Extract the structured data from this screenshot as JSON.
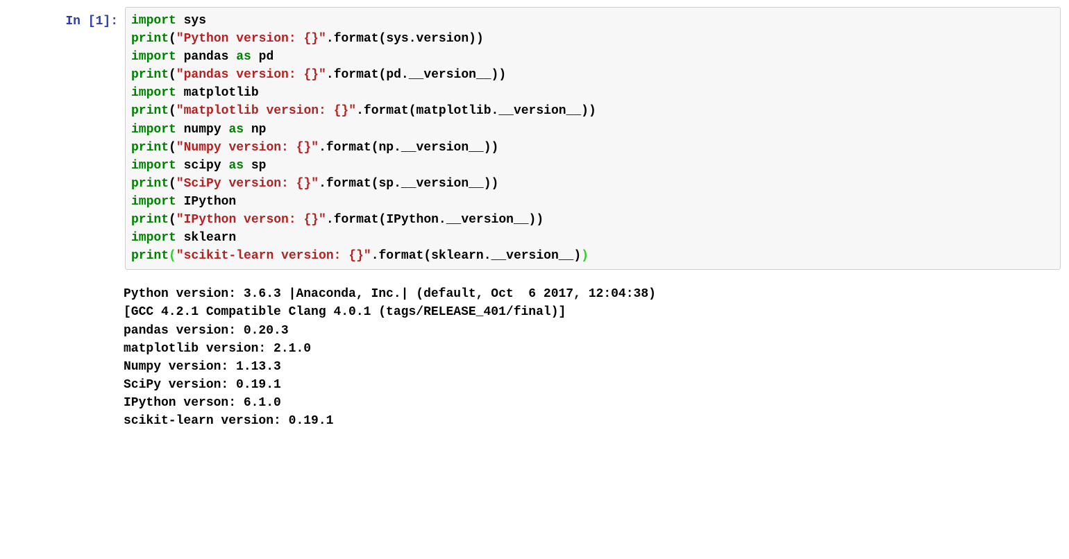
{
  "prompt": {
    "in_label": "In",
    "number": "1"
  },
  "code": {
    "l1_kw": "import",
    "l1_nm": " sys",
    "l2_fn": "print",
    "l2_p1": "(",
    "l2_str": "\"Python version: {}\"",
    "l2_dot": ".",
    "l2_fmt": "format",
    "l2_p2": "(",
    "l2_arg": "sys.version",
    "l2_p3": ")",
    "l2_p4": ")",
    "l3_kw": "import",
    "l3_nm": " pandas ",
    "l3_as": "as",
    "l3_al": " pd",
    "l4_fn": "print",
    "l4_p1": "(",
    "l4_str": "\"pandas version: {}\"",
    "l4_dot": ".",
    "l4_fmt": "format",
    "l4_p2": "(",
    "l4_arg": "pd.__version__",
    "l4_p3": ")",
    "l4_p4": ")",
    "l5_kw": "import",
    "l5_nm": " matplotlib",
    "l6_fn": "print",
    "l6_p1": "(",
    "l6_str": "\"matplotlib version: {}\"",
    "l6_dot": ".",
    "l6_fmt": "format",
    "l6_p2": "(",
    "l6_arg": "matplotlib.__version__",
    "l6_p3": ")",
    "l6_p4": ")",
    "l7_kw": "import",
    "l7_nm": " numpy ",
    "l7_as": "as",
    "l7_al": " np",
    "l8_fn": "print",
    "l8_p1": "(",
    "l8_str": "\"Numpy version: {}\"",
    "l8_dot": ".",
    "l8_fmt": "format",
    "l8_p2": "(",
    "l8_arg": "np.__version__",
    "l8_p3": ")",
    "l8_p4": ")",
    "l9_kw": "import",
    "l9_nm": " scipy ",
    "l9_as": "as",
    "l9_al": " sp",
    "l10_fn": "print",
    "l10_p1": "(",
    "l10_str": "\"SciPy version: {}\"",
    "l10_dot": ".",
    "l10_fmt": "format",
    "l10_p2": "(",
    "l10_arg": "sp.__version__",
    "l10_p3": ")",
    "l10_p4": ")",
    "l11_kw": "import",
    "l11_nm": " IPython",
    "l12_fn": "print",
    "l12_p1": "(",
    "l12_str": "\"IPython verson: {}\"",
    "l12_dot": ".",
    "l12_fmt": "format",
    "l12_p2": "(",
    "l12_arg": "IPython.__version__",
    "l12_p3": ")",
    "l12_p4": ")",
    "l13_kw": "import",
    "l13_nm": " sklearn",
    "l14_fn": "print",
    "l14_p1": "(",
    "l14_str": "\"scikit-learn version: {}\"",
    "l14_dot": ".",
    "l14_fmt": "format",
    "l14_p2": "(",
    "l14_arg": "sklearn.__version__",
    "l14_p3": ")",
    "l14_p4": ")"
  },
  "output": {
    "line1": "Python version: 3.6.3 |Anaconda, Inc.| (default, Oct  6 2017, 12:04:38)",
    "line2": "[GCC 4.2.1 Compatible Clang 4.0.1 (tags/RELEASE_401/final)]",
    "line3": "pandas version: 0.20.3",
    "line4": "matplotlib version: 2.1.0",
    "line5": "Numpy version: 1.13.3",
    "line6": "SciPy version: 0.19.1",
    "line7": "IPython verson: 6.1.0",
    "line8": "scikit-learn version: 0.19.1"
  }
}
